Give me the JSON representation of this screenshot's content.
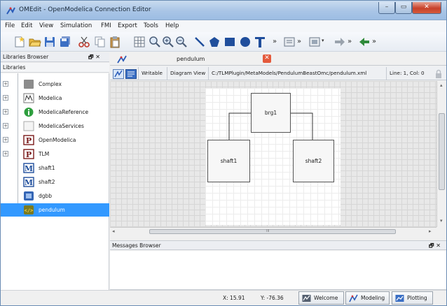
{
  "window": {
    "title": "OMEdit - OpenModelica Connection Editor",
    "controls": {
      "minimize": "–",
      "maximize": "▭",
      "close": "✕"
    }
  },
  "menu": [
    "File",
    "Edit",
    "View",
    "Simulation",
    "FMI",
    "Export",
    "Tools",
    "Help"
  ],
  "toolbar": {
    "more": "»",
    "buttons": [
      "new-icon",
      "open-icon",
      "save-icon",
      "save-all-icon",
      "cut-icon",
      "copy-icon",
      "paste-icon",
      "grid-icon",
      "zoom-reset-icon",
      "zoom-in-icon",
      "zoom-out-icon",
      "line-icon",
      "polygon-icon",
      "rectangle-icon",
      "ellipse-icon",
      "text-icon",
      "simulate-icon",
      "check-icon",
      "connect-icon",
      "arrow-icon"
    ]
  },
  "libraries": {
    "header": "Libraries Browser",
    "header_controls": "🗗 ✕",
    "sub": "Libraries",
    "items": [
      {
        "label": "Complex",
        "icon": "complex-icon",
        "expandable": true
      },
      {
        "label": "Modelica",
        "icon": "modelica-icon",
        "expandable": true
      },
      {
        "label": "ModelicaReference",
        "icon": "info-icon",
        "expandable": true
      },
      {
        "label": "ModelicaServices",
        "icon": "package-icon",
        "expandable": true
      },
      {
        "label": "OpenModelica",
        "icon": "p-package-icon",
        "expandable": true
      },
      {
        "label": "TLM",
        "icon": "p-package-icon",
        "expandable": true
      },
      {
        "label": "shaft1",
        "icon": "m-model-icon",
        "expandable": false
      },
      {
        "label": "shaft2",
        "icon": "m-model-icon",
        "expandable": false
      },
      {
        "label": "dgbb",
        "icon": "tlm-meta-icon",
        "expandable": false
      },
      {
        "label": "pendulum",
        "icon": "xml-icon",
        "expandable": false,
        "selected": true
      }
    ]
  },
  "editor": {
    "tab_title": "pendulum",
    "tab_close": "✕",
    "info": {
      "writable": "Writable",
      "view": "Diagram View",
      "path": "C:/TLMPlugin/MetaModels/PendulumBeastOmc/pendulum.xml",
      "cursor": "Line: 1, Col: 0"
    },
    "components": [
      "brg1",
      "shaft1",
      "shaft2"
    ],
    "hscroll_mark": "III"
  },
  "messages": {
    "header": "Messages Browser",
    "header_controls": "🗗 ✕"
  },
  "status": {
    "x": "X: 15.91",
    "y": "Y: -76.36",
    "perspectives": [
      "Welcome",
      "Modeling",
      "Plotting"
    ]
  },
  "colors": {
    "selection": "#3399ff",
    "titlebar": "#a9c5e6",
    "close": "#c7412a"
  }
}
